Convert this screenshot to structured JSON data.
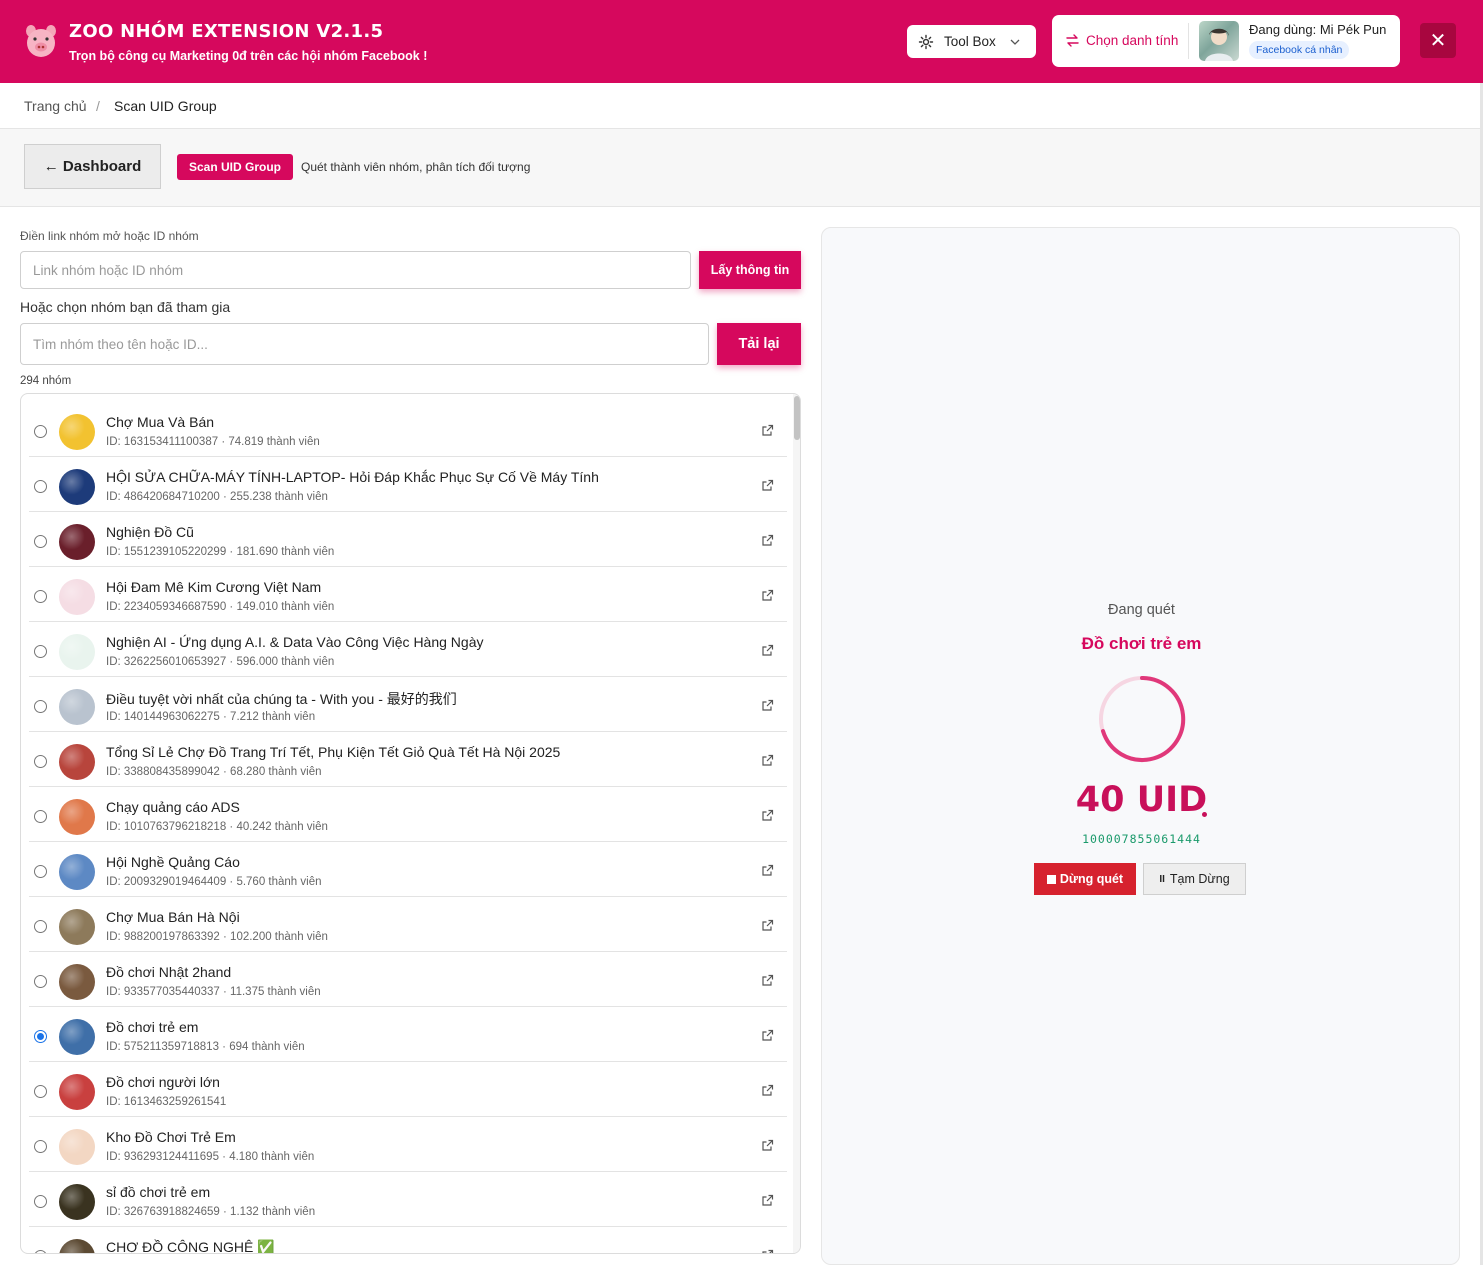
{
  "header": {
    "title": "ZOO NHÓM EXTENSION V2.1.5",
    "subtitle": "Trọn bộ công cụ Marketing 0đ trên các hội nhóm Facebook !",
    "logo_icon": "pig-icon",
    "toolbox_label": "Tool Box",
    "choose_identity_label": "Chọn danh tính",
    "current_user": "Đang dùng: Mi Pék Pun",
    "account_type": "Facebook cá nhân",
    "close_label": "✕",
    "brand_color": "#d6085d"
  },
  "breadcrumb": {
    "home": "Trang chủ",
    "separator": "/",
    "current": "Scan UID Group"
  },
  "page_header": {
    "back_label": "← Dashboard",
    "tag": "Scan UID Group",
    "description": "Quét thành viên nhóm, phân tích đối tượng"
  },
  "form": {
    "link_label": "Điền link nhóm mở hoặc ID nhóm",
    "link_placeholder": "Link nhóm hoặc ID nhóm",
    "get_info_label": "Lấy thông tin",
    "joined_label": "Hoặc chọn nhóm bạn đã tham gia",
    "search_placeholder": "Tìm nhóm theo tên hoặc ID...",
    "reload_label": "Tải lại",
    "group_count": "294 nhóm"
  },
  "groups": [
    {
      "name": "Chợ Mua Và Bán",
      "meta": "ID: 163153411100387 · 74.819 thành viên",
      "selected": false,
      "color": "#f2c230"
    },
    {
      "name": "HỘI SỬA CHỮA-MÁY TÍNH-LAPTOP- Hỏi Đáp Khắc Phục Sự Cố Về Máy Tính",
      "meta": "ID: 486420684710200 · 255.238 thành viên",
      "selected": false,
      "color": "#1d3b7a"
    },
    {
      "name": "Nghiện Đồ Cũ",
      "meta": "ID: 1551239105220299 · 181.690 thành viên",
      "selected": false,
      "color": "#6a1f2b"
    },
    {
      "name": "Hội Đam Mê Kim Cương Việt Nam",
      "meta": "ID: 2234059346687590 · 149.010 thành viên",
      "selected": false,
      "color": "#f5dde4"
    },
    {
      "name": "Nghiện AI - Ứng dụng A.I. & Data Vào Công Việc Hàng Ngày",
      "meta": "ID: 3262256010653927 · 596.000 thành viên",
      "selected": false,
      "color": "#e9f4ee"
    },
    {
      "name": "Điều tuyệt vời nhất của chúng ta - With you - 最好的我们",
      "meta": "ID: 140144963062275 · 7.212 thành viên",
      "selected": false,
      "color": "#b9c3cf"
    },
    {
      "name": "Tổng Sỉ Lẻ Chợ Đồ Trang Trí Tết, Phụ Kiện Tết Giỏ Quà Tết Hà Nội 2025",
      "meta": "ID: 338808435899042 · 68.280 thành viên",
      "selected": false,
      "color": "#b8453c"
    },
    {
      "name": "Chạy quảng cáo ADS",
      "meta": "ID: 1010763796218218 · 40.242 thành viên",
      "selected": false,
      "color": "#e0784a"
    },
    {
      "name": "Hội Nghề Quảng Cáo",
      "meta": "ID: 2009329019464409 · 5.760 thành viên",
      "selected": false,
      "color": "#5d89c4"
    },
    {
      "name": "Chợ Mua Bán Hà Nội",
      "meta": "ID: 988200197863392 · 102.200 thành viên",
      "selected": false,
      "color": "#8d7a5b"
    },
    {
      "name": "Đồ chơi Nhật 2hand",
      "meta": "ID: 933577035440337 · 11.375 thành viên",
      "selected": false,
      "color": "#7a5a3f"
    },
    {
      "name": "Đồ chơi trẻ em",
      "meta": "ID: 575211359718813 · 694 thành viên",
      "selected": true,
      "color": "#3f6fa8"
    },
    {
      "name": "Đồ chơi người lớn",
      "meta": "ID: 1613463259261541",
      "selected": false,
      "color": "#c9403f"
    },
    {
      "name": "Kho Đồ Chơi Trẻ Em",
      "meta": "ID: 936293124411695 · 4.180 thành viên",
      "selected": false,
      "color": "#f3d7c3"
    },
    {
      "name": "sỉ đồ chơi trẻ em",
      "meta": "ID: 326763918824659 · 1.132 thành viên",
      "selected": false,
      "color": "#3a3320"
    },
    {
      "name": "CHỢ ĐỒ CÔNG NGHỆ ✅",
      "meta": "",
      "selected": false,
      "color": "#5c4a33"
    }
  ],
  "scan": {
    "status_label": "Đang quét",
    "group_name": "Đồ chơi trẻ em",
    "uid_count": "40 UID",
    "current_uid": "100007855061444",
    "stop_label": "Dừng quét",
    "pause_label": "Tạm Dừng"
  }
}
